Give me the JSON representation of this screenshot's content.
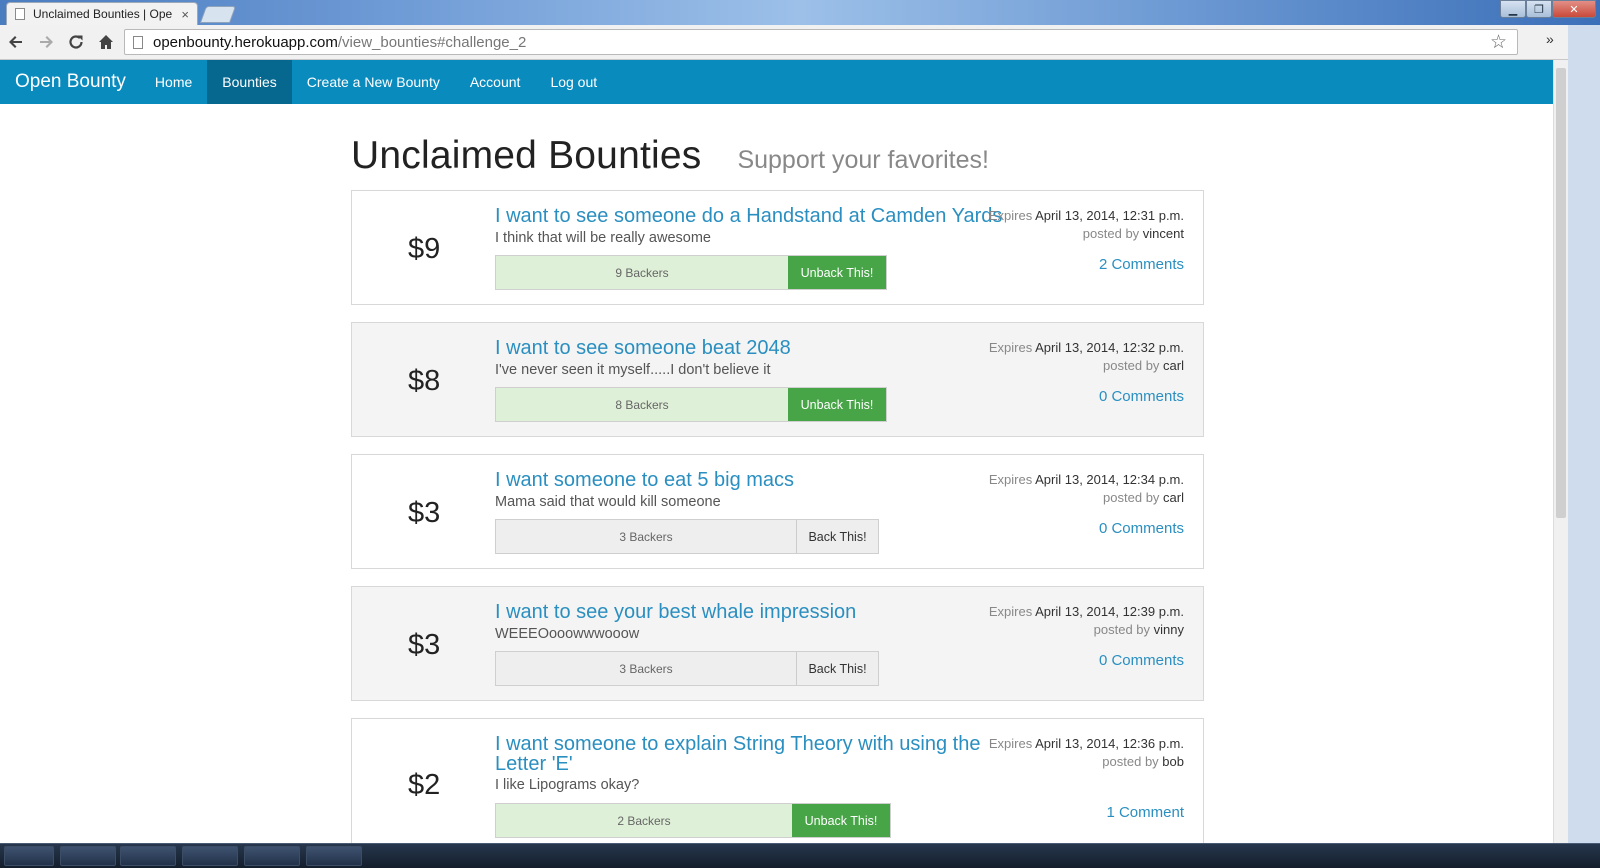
{
  "browser": {
    "tab_title": "Unclaimed Bounties | Ope",
    "tab_close": "×",
    "url_host": "openbounty.herokuapp.com",
    "url_path": "/view_bounties#challenge_2",
    "win_minimize": "▁",
    "win_restore": "❐",
    "win_close": "✕"
  },
  "navbar": {
    "brand": "Open Bounty",
    "links": [
      "Home",
      "Bounties",
      "Create a New Bounty",
      "Account",
      "Log out"
    ],
    "active": "Bounties",
    "color": "#0a8bbe"
  },
  "page": {
    "title": "Unclaimed Bounties",
    "subtitle": "Support your favorites!"
  },
  "labels": {
    "expires": "Expires",
    "posted_by": "posted by"
  },
  "bounties": [
    {
      "amount": "$9",
      "title": "I want to see someone do a Handstand at Camden Yards",
      "description": "I think that will be really awesome",
      "backers": "9 Backers",
      "action": "Unback This!",
      "backed": true,
      "expires": "April 13, 2014, 12:31 p.m.",
      "author": "vincent",
      "comments": "2 Comments"
    },
    {
      "amount": "$8",
      "title": "I want to see someone beat 2048",
      "description": "I've never seen it myself.....I don't believe it",
      "backers": "8 Backers",
      "action": "Unback This!",
      "backed": true,
      "expires": "April 13, 2014, 12:32 p.m.",
      "author": "carl",
      "comments": "0 Comments"
    },
    {
      "amount": "$3",
      "title": "I want someone to eat 5 big macs",
      "description": "Mama said that would kill someone",
      "backers": "3 Backers",
      "action": "Back This!",
      "backed": false,
      "expires": "April 13, 2014, 12:34 p.m.",
      "author": "carl",
      "comments": "0 Comments"
    },
    {
      "amount": "$3",
      "title": "I want to see your best whale impression",
      "description": "WEEEOooowwwooow",
      "backers": "3 Backers",
      "action": "Back This!",
      "backed": false,
      "expires": "April 13, 2014, 12:39 p.m.",
      "author": "vinny",
      "comments": "0 Comments"
    },
    {
      "amount": "$2",
      "title": "I want someone to explain String Theory with using the Letter 'E'",
      "description": "I like Lipograms okay?",
      "backers": "2 Backers",
      "action": "Unback This!",
      "backed": true,
      "expires": "April 13, 2014, 12:36 p.m.",
      "author": "bob",
      "comments": "1 Comment"
    }
  ],
  "colors": {
    "link": "#2a8fc0",
    "backed_bar": "#dff0d8",
    "unback_button": "#47a447",
    "unbacked_bar": "#eeeeee"
  },
  "icons": [
    "back-arrow-icon",
    "forward-arrow-icon",
    "reload-icon",
    "home-icon",
    "bookmark-star-icon",
    "chrome-menu-icon"
  ]
}
